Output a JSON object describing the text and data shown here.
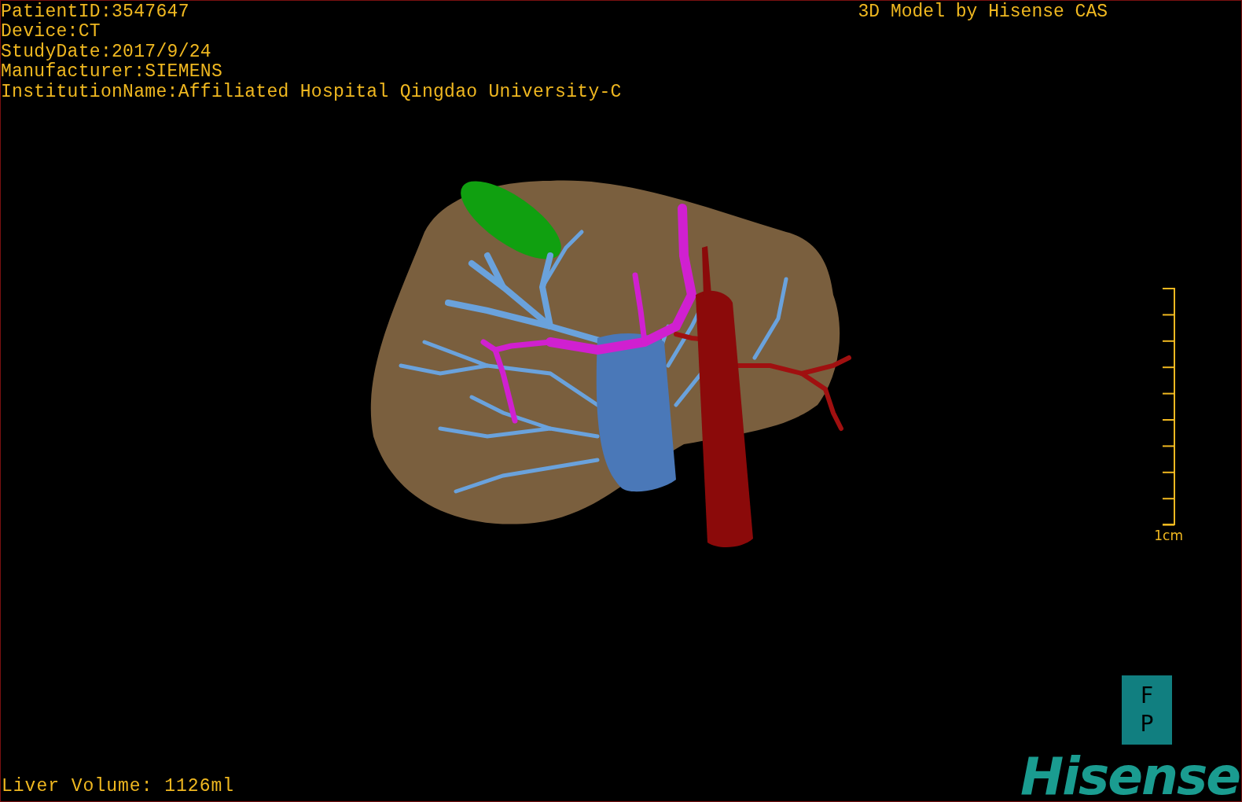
{
  "header": {
    "info_lines": [
      "PatientID:3547647",
      "Device:CT",
      "StudyDate:2017/9/24",
      "Manufacturer:SIEMENS",
      "InstitutionName:Affiliated Hospital Qingdao University-C"
    ],
    "title": "3D Model by Hisense CAS"
  },
  "scale_bar": {
    "label": "1cm"
  },
  "footer": {
    "liver_volume": "Liver Volume: 1126ml",
    "orientation": [
      "F",
      "P"
    ],
    "logo": "Hisense"
  }
}
